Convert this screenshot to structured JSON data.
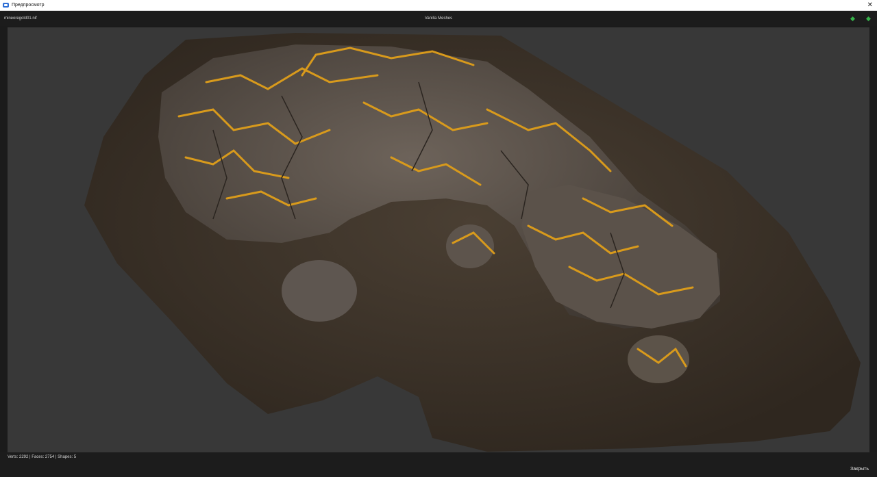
{
  "window": {
    "title": "Предпросмотр",
    "close_glyph": "✕"
  },
  "toolbar": {
    "filename": "mineoregold01.nif",
    "library": "Vanilla Meshes"
  },
  "status": {
    "stats": "Verts: 2292 | Faces: 2754 | Shapes: 5"
  },
  "footer": {
    "close_label": "Закрыть"
  },
  "colors": {
    "nav_arrow": "#36b34a",
    "viewport_bg": "#383838",
    "gold_vein": "#d89a1c",
    "rock": "#5a5048",
    "dirt": "#3d3329"
  }
}
